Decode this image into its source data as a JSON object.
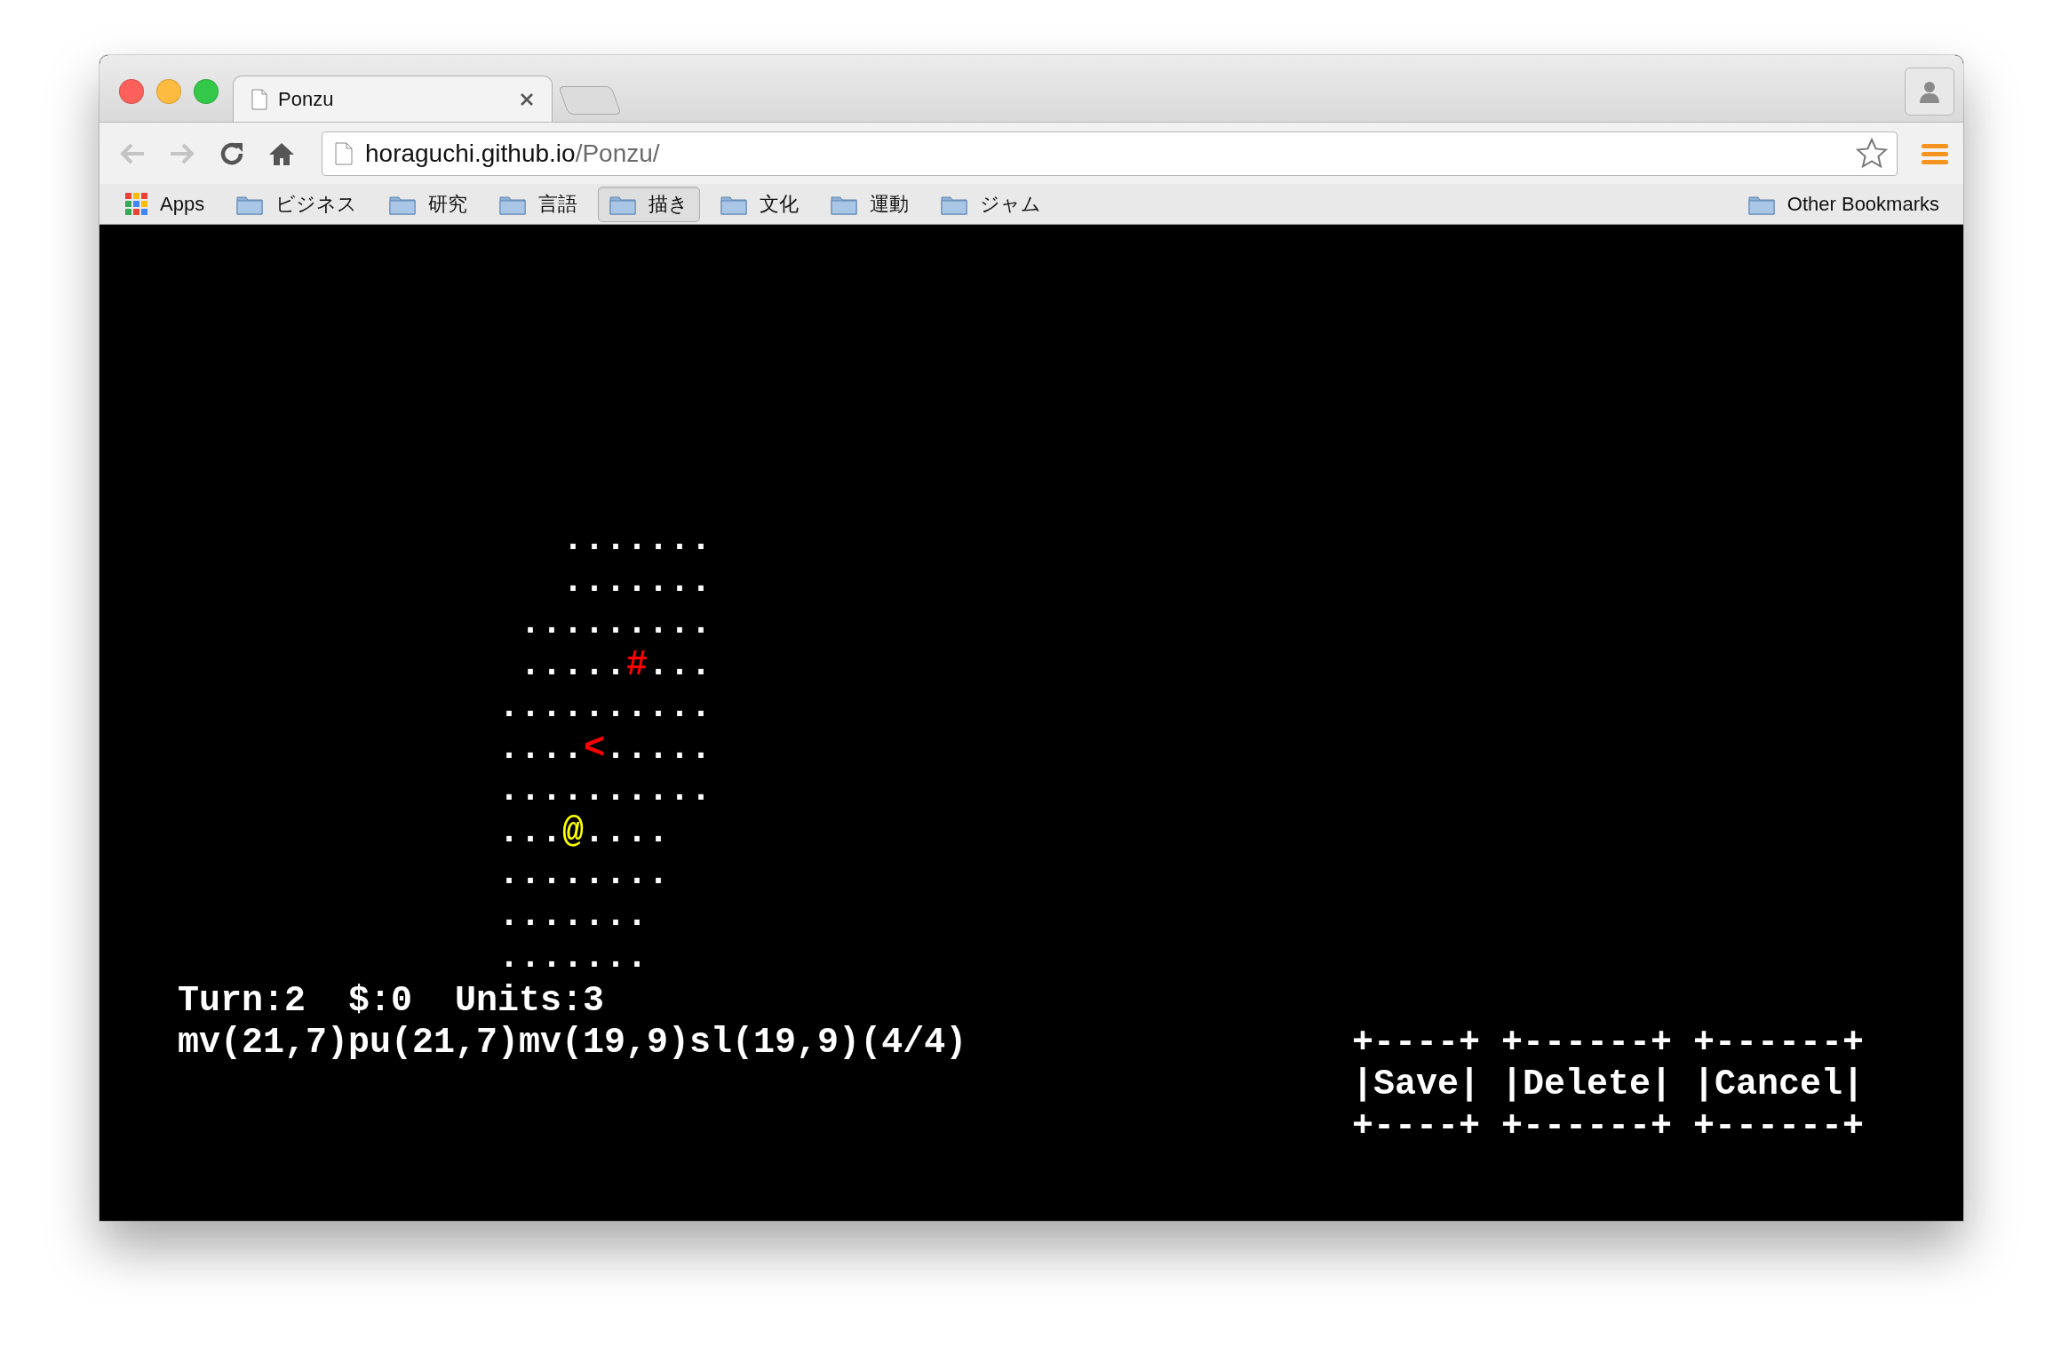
{
  "window": {
    "tab": {
      "title": "Ponzu",
      "selected": true
    },
    "address": {
      "host": "horaguchi.github.io",
      "path": "/Ponzu/"
    },
    "bookmarks": [
      {
        "label": "Apps",
        "kind": "apps",
        "selected": false
      },
      {
        "label": "ビジネス",
        "kind": "folder",
        "selected": false
      },
      {
        "label": "研究",
        "kind": "folder",
        "selected": false
      },
      {
        "label": "言語",
        "kind": "folder",
        "selected": false
      },
      {
        "label": "描き",
        "kind": "folder",
        "selected": true
      },
      {
        "label": "文化",
        "kind": "folder",
        "selected": false
      },
      {
        "label": "運動",
        "kind": "folder",
        "selected": false
      },
      {
        "label": "ジャム",
        "kind": "folder",
        "selected": false
      }
    ],
    "other_bookmarks": {
      "label": "Other Bookmarks"
    }
  },
  "game": {
    "map": {
      "segments": [
        {
          "text": "   .......\n   .......\n .........\n ....."
        },
        {
          "text": "#",
          "color": "#ff0000"
        },
        {
          "text": "...\n..........\n...."
        },
        {
          "text": "<",
          "color": "#ff0000"
        },
        {
          "text": ".....\n..........\n..."
        },
        {
          "text": "@",
          "color": "#ffff00"
        },
        {
          "text": "....\n........\n.......\n......."
        }
      ]
    },
    "status": "Turn:2  $:0  Units:3",
    "command_log": "mv(21,7)pu(21,7)mv(19,9)sl(19,9)(4/4)",
    "buttons": [
      {
        "top": "+----+",
        "label": "|Save|",
        "bottom": "+----+"
      },
      {
        "top": "+------+",
        "label": "|Delete|",
        "bottom": "+------+"
      },
      {
        "top": "+------+",
        "label": "|Cancel|",
        "bottom": "+------+"
      }
    ]
  }
}
